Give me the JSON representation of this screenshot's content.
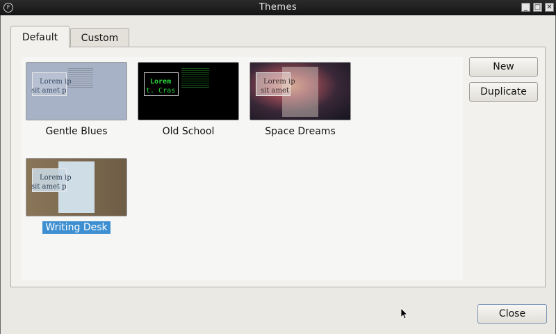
{
  "window": {
    "title": "Themes"
  },
  "tabs": [
    {
      "label": "Default",
      "active": true
    },
    {
      "label": "Custom",
      "active": false
    }
  ],
  "themes": [
    {
      "name": "Gentle Blues",
      "sample_line1": "Lorem ip",
      "sample_line2": "sit amet p",
      "bg": "#a8b3c8",
      "text": "#37465e",
      "selected": false
    },
    {
      "name": "Old School",
      "sample_line1": "Lorem",
      "sample_line2": "t. Cras",
      "bg": "#000000",
      "text": "#22d62e",
      "selected": false
    },
    {
      "name": "Space Dreams",
      "sample_line1": "Lorem ip",
      "sample_line2": "sit amet",
      "bg": "#4a2a33",
      "text": "#3a2a2a",
      "selected": false
    },
    {
      "name": "Writing Desk",
      "sample_line1": "Lorem ip",
      "sample_line2": "sit amet p",
      "bg": "#7a6a55",
      "text": "#2a3a4a",
      "selected": true
    }
  ],
  "buttons": {
    "new_label": "New",
    "duplicate_label": "Duplicate",
    "close_label": "Close"
  },
  "colors": {
    "selection": "#3d8fd1",
    "titlebar": "#1f1f1f"
  }
}
